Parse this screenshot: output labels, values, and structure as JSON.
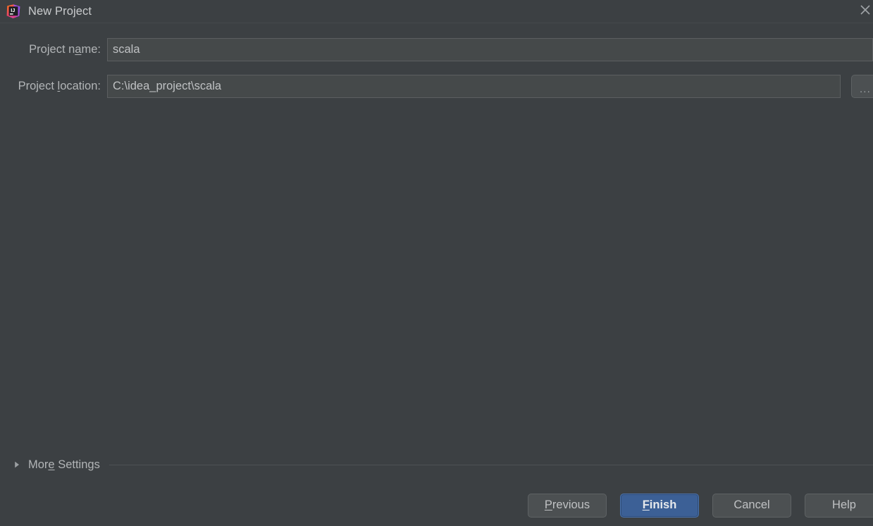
{
  "window": {
    "title": "New Project",
    "app_icon": "intellij-idea-icon",
    "close_icon": "close-icon"
  },
  "form": {
    "fields": [
      {
        "name": "project-name",
        "label_before": "Project n",
        "label_mnemonic": "a",
        "label_after": "me:",
        "value": "scala",
        "placeholder": ""
      },
      {
        "name": "project-location",
        "label_before": "Project ",
        "label_mnemonic": "l",
        "label_after": "ocation:",
        "value": "C:\\idea_project\\scala",
        "placeholder": ""
      }
    ],
    "browse_button": {
      "label": "...",
      "icon": "ellipsis-icon"
    }
  },
  "more_settings": {
    "label_before": "Mor",
    "label_mnemonic": "e",
    "label_after": " Settings",
    "expanded": false,
    "triangle_icon": "chevron-right-icon"
  },
  "buttons": [
    {
      "name": "previous",
      "before": "",
      "mnemonic": "P",
      "after": "revious",
      "primary": false
    },
    {
      "name": "finish",
      "before": "",
      "mnemonic": "F",
      "after": "inish",
      "primary": true
    },
    {
      "name": "cancel",
      "before": "Cancel",
      "mnemonic": "",
      "after": "",
      "primary": false
    },
    {
      "name": "help",
      "before": "Help",
      "mnemonic": "",
      "after": "",
      "primary": false
    }
  ],
  "colors": {
    "dialog_background": "#3c4043",
    "field_background": "#45494a",
    "field_border": "#5c5f61",
    "button_background": "#4c5052",
    "button_border": "#5e6264",
    "primary_button_background": "#3c6096",
    "primary_button_border": "#4b74b0",
    "text": "#b2b5b7",
    "separator": "#4e5255"
  }
}
